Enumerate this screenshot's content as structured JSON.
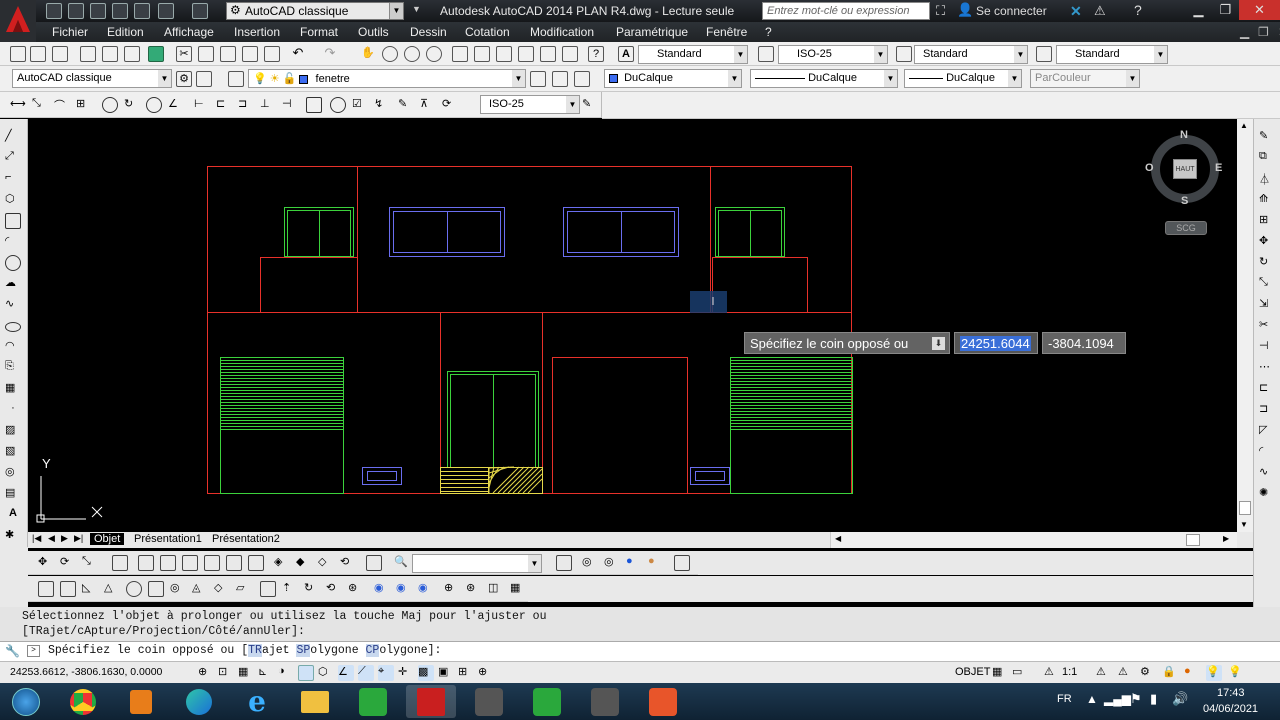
{
  "titlebar": {
    "workspace": "AutoCAD classique",
    "app_title": "Autodesk AutoCAD 2014    PLAN R4.dwg - Lecture seule",
    "search_placeholder": "Entrez mot-clé ou expression",
    "login": "Se connecter",
    "help": "?"
  },
  "menu": [
    "Fichier",
    "Edition",
    "Affichage",
    "Insertion",
    "Format",
    "Outils",
    "Dessin",
    "Cotation",
    "Modification",
    "Paramétrique",
    "Fenêtre",
    "?"
  ],
  "styles": {
    "text_style": "Standard",
    "dim_style": "ISO-25",
    "table_style": "Standard",
    "mleader_style": "Standard"
  },
  "layers": {
    "workspace": "AutoCAD classique",
    "current_layer": "fenetre",
    "color": "DuCalque",
    "linetype": "DuCalque",
    "lineweight": "DuCalque",
    "plotstyle": "ParCouleur"
  },
  "dim_toolbar": {
    "style": "ISO-25"
  },
  "viewcube": {
    "north": "N",
    "south": "S",
    "east": "E",
    "west": "O",
    "face": "HAUT",
    "ucs": "SCG"
  },
  "axes": {
    "y": "Y",
    "x": "X"
  },
  "dynamic_input": {
    "prompt": "Spécifiez le coin opposé ou",
    "x_value": "24251.6044",
    "y_value": "-3804.1094"
  },
  "layout_tabs": [
    "Objet",
    "Présentation1",
    "Présentation2"
  ],
  "command": {
    "history_line1": "Sélectionnez l'objet à prolonger ou utilisez la touche Maj pour l'ajuster ou",
    "history_line2": "[TRajet/cApture/Projection/Côté/annUler]:",
    "prompt_prefix": "Spécifiez le coin opposé ou [",
    "opt1_key": "TR",
    "opt1_rest": "ajet ",
    "opt2_key": "SP",
    "opt2_rest": "olygone ",
    "opt3_key": "CP",
    "opt3_rest": "olygone",
    "prompt_suffix": "]:"
  },
  "status": {
    "coords": "24253.6612, -3806.1630, 0.0000",
    "model": "OBJET",
    "scale": "1:1"
  },
  "taskbar": {
    "lang": "FR",
    "time": "17:43",
    "date": "04/06/2021"
  },
  "colors": {
    "wall": "#e8312a",
    "window": "#3cd23c",
    "blue_window": "#6a6ef0",
    "hatch": "#e6d84a"
  }
}
